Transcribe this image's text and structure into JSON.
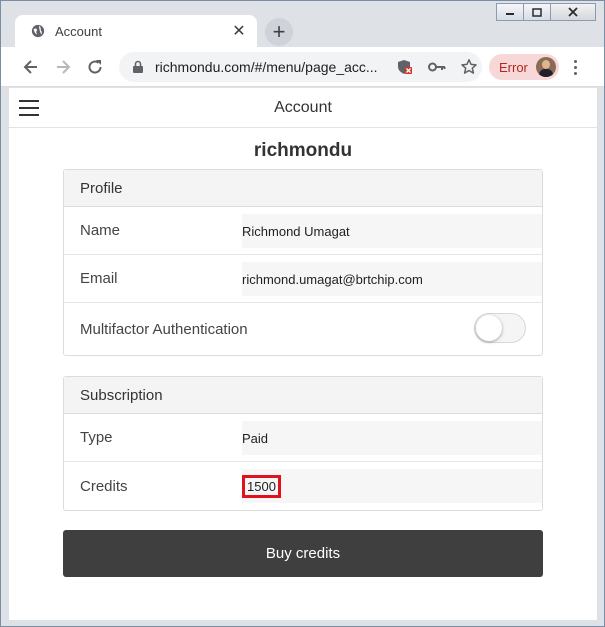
{
  "browser": {
    "tab_title": "Account",
    "tab_close": "✕",
    "new_tab": "+",
    "url": "richmondu.com/#/menu/page_acc...",
    "error_label": "Error",
    "window_controls": {
      "minimize": "▭",
      "maximize": "□",
      "close": "✕"
    }
  },
  "app": {
    "header_title": "Account",
    "username": "richmondu"
  },
  "profile": {
    "title": "Profile",
    "name_label": "Name",
    "name_value": "Richmond Umagat",
    "email_label": "Email",
    "email_value": "richmond.umagat@brtchip.com",
    "mfa_label": "Multifactor Authentication",
    "mfa_enabled": false
  },
  "subscription": {
    "title": "Subscription",
    "type_label": "Type",
    "type_value": "Paid",
    "credits_label": "Credits",
    "credits_value": "1500"
  },
  "actions": {
    "buy_credits": "Buy credits"
  },
  "colors": {
    "button_bg": "#3f3f3f",
    "highlight_border": "#e0121b",
    "error_pill_bg": "#f7d7d7"
  },
  "icons": [
    "globe-icon",
    "close-icon",
    "plus-icon",
    "back-arrow-icon",
    "forward-arrow-icon",
    "reload-icon",
    "lock-icon",
    "blocked-content-icon",
    "key-icon",
    "star-icon",
    "avatar",
    "kebab-menu-icon",
    "hamburger-icon"
  ]
}
